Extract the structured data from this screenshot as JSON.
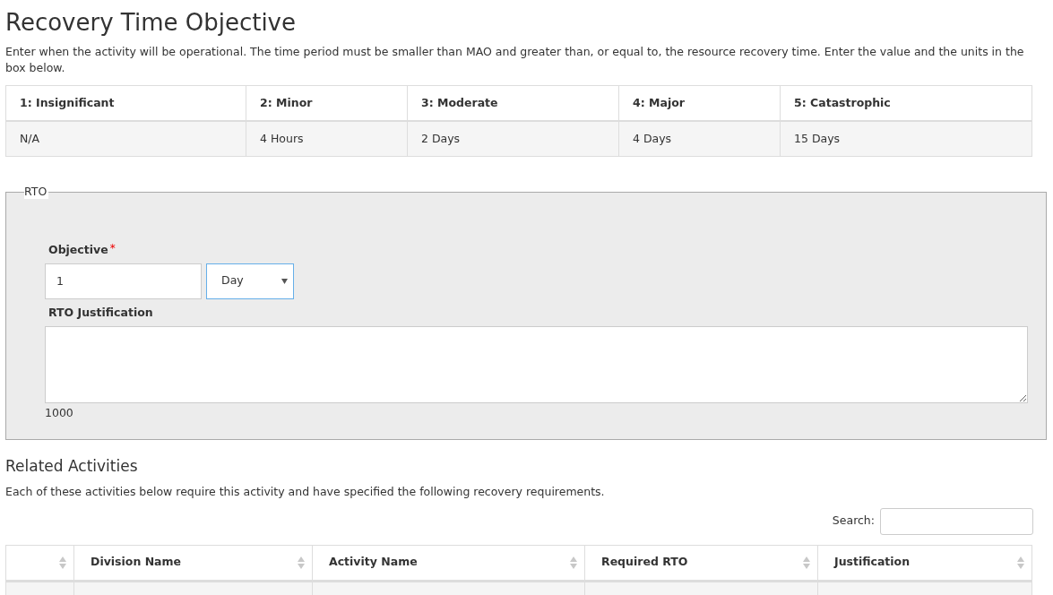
{
  "title": "Recovery Time Objective",
  "intro": "Enter when the activity will be operational. The time period must be smaller than MAO and greater than, or equal to, the resource recovery time. Enter the value and the units in the box below.",
  "impact_table": {
    "columns": [
      "1: Insignificant",
      "2: Minor",
      "3: Moderate",
      "4: Major",
      "5: Catastrophic"
    ],
    "rows": [
      [
        "N/A",
        "4 Hours",
        "2 Days",
        "4 Days",
        "15 Days"
      ]
    ]
  },
  "rto": {
    "legend": "RTO",
    "objective_label": "Objective",
    "required_marker": "*",
    "objective_value": "1",
    "unit_value": "Day",
    "justification_label": "RTO Justification",
    "char_count": "1000"
  },
  "related": {
    "title": "Related Activities",
    "description": "Each of these activities below require this activity and have specified the following recovery requirements.",
    "search_label": "Search:",
    "columns": [
      "",
      "Division Name",
      "Activity Name",
      "Required RTO",
      "Justification"
    ]
  }
}
